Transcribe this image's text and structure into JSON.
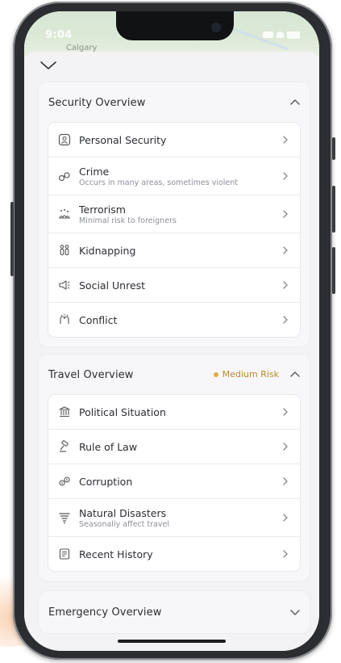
{
  "status": {
    "time": "9:04"
  },
  "map": {
    "label": "Calgary"
  },
  "colors": {
    "risk_medium": "#e2ad3e",
    "text": "#2b2d33",
    "subtext": "#8c8f97"
  },
  "sections": {
    "security": {
      "title": "Security Overview",
      "expanded": true,
      "items": [
        {
          "icon": "shield-person-icon",
          "label": "Personal Security",
          "sub": ""
        },
        {
          "icon": "handcuffs-icon",
          "label": "Crime",
          "sub": "Occurs in many areas, sometimes violent"
        },
        {
          "icon": "explosion-icon",
          "label": "Terrorism",
          "sub": "Minimal risk to foreigners"
        },
        {
          "icon": "people-icon",
          "label": "Kidnapping",
          "sub": ""
        },
        {
          "icon": "megaphone-icon",
          "label": "Social Unrest",
          "sub": ""
        },
        {
          "icon": "conflict-icon",
          "label": "Conflict",
          "sub": ""
        }
      ]
    },
    "travel": {
      "title": "Travel Overview",
      "risk_label": "Medium Risk",
      "expanded": true,
      "items": [
        {
          "icon": "building-icon",
          "label": "Political Situation",
          "sub": ""
        },
        {
          "icon": "gavel-icon",
          "label": "Rule of Law",
          "sub": ""
        },
        {
          "icon": "coins-icon",
          "label": "Corruption",
          "sub": ""
        },
        {
          "icon": "tornado-icon",
          "label": "Natural Disasters",
          "sub": "Seasonally affect travel"
        },
        {
          "icon": "document-icon",
          "label": "Recent History",
          "sub": ""
        }
      ]
    },
    "emergency": {
      "title": "Emergency Overview",
      "expanded": false
    }
  }
}
